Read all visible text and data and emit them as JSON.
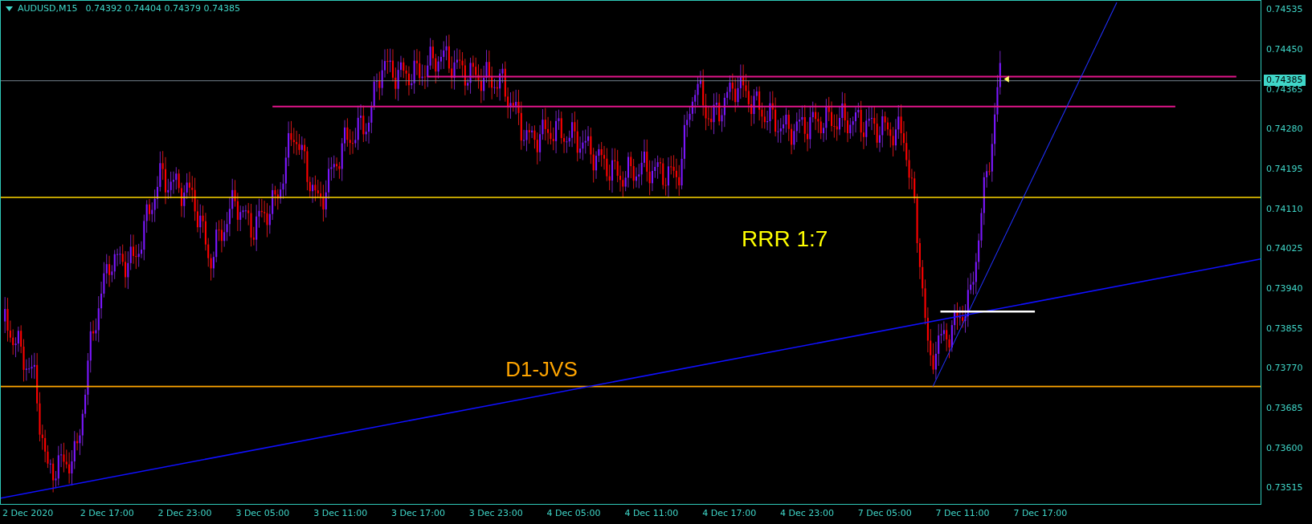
{
  "chart_header": {
    "symbol": "AUDUSD,M15",
    "prices": "0.74392 0.74404 0.74379 0.74385"
  },
  "price_axis": {
    "labels": [
      "0.74535",
      "0.74450",
      "0.74365",
      "0.74280",
      "0.74195",
      "0.74110",
      "0.74025",
      "0.73940",
      "0.73855",
      "0.73770",
      "0.73685",
      "0.73600",
      "0.73515"
    ],
    "current_price": "0.74385"
  },
  "time_axis": {
    "labels": [
      "2 Dec 2020",
      "2 Dec 17:00",
      "2 Dec 23:00",
      "3 Dec 05:00",
      "3 Dec 11:00",
      "3 Dec 17:00",
      "3 Dec 23:00",
      "4 Dec 05:00",
      "4 Dec 11:00",
      "4 Dec 17:00",
      "4 Dec 23:00",
      "7 Dec 05:00",
      "7 Dec 11:00",
      "7 Dec 17:00"
    ]
  },
  "annotations": [
    {
      "text": "RRR 1:7",
      "color": "#ffff00"
    },
    {
      "text": "D1-JVS",
      "color": "#ffa500"
    }
  ]
}
